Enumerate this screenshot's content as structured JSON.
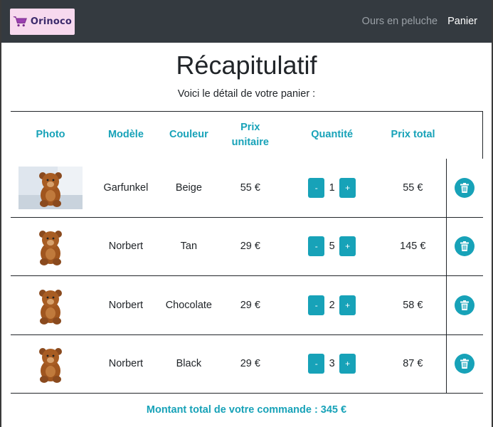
{
  "colors": {
    "accent": "#17a2b8",
    "navbar": "#343a40",
    "logo_bg": "#f7d9ee"
  },
  "navbar": {
    "logo_text": "Orinoco",
    "links": [
      {
        "label": "Ours en peluche",
        "active": false
      },
      {
        "label": "Panier",
        "active": true
      }
    ]
  },
  "page": {
    "title": "Récapitulatif",
    "subtitle": "Voici le détail de votre panier :"
  },
  "table": {
    "headers": {
      "photo": "Photo",
      "model": "Modèle",
      "color": "Couleur",
      "unit_price": "Prix unitaire",
      "quantity": "Quantité",
      "total_price": "Prix total"
    },
    "rows": [
      {
        "photo_icon": "teddy-bear-photo",
        "model": "Garfunkel",
        "color": "Beige",
        "unit_price": "55 €",
        "minus": "-",
        "quantity": "1",
        "plus": "+",
        "total": "55 €",
        "delete_icon": "trash-icon"
      },
      {
        "photo_icon": "teddy-bear-photo",
        "model": "Norbert",
        "color": "Tan",
        "unit_price": "29 €",
        "minus": "-",
        "quantity": "5",
        "plus": "+",
        "total": "145 €",
        "delete_icon": "trash-icon"
      },
      {
        "photo_icon": "teddy-bear-photo",
        "model": "Norbert",
        "color": "Chocolate",
        "unit_price": "29 €",
        "minus": "-",
        "quantity": "2",
        "plus": "+",
        "total": "58 €",
        "delete_icon": "trash-icon"
      },
      {
        "photo_icon": "teddy-bear-photo",
        "model": "Norbert",
        "color": "Black",
        "unit_price": "29 €",
        "minus": "-",
        "quantity": "3",
        "plus": "+",
        "total": "87 €",
        "delete_icon": "trash-icon"
      }
    ]
  },
  "summary": {
    "total_text": "Montant total de votre commande : 345 €"
  }
}
